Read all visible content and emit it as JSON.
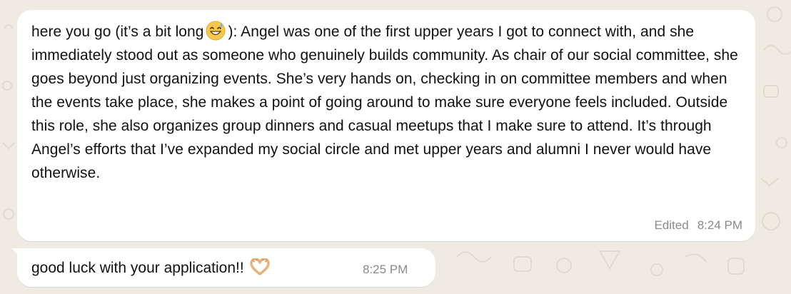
{
  "messages": [
    {
      "text_pre": "here you go (it’s a bit long",
      "emoji": "grinning-sweat-emoji",
      "text_post": "): Angel was one of the first upper years I got to connect with, and she immediately stood out as someone who genuinely builds community. As chair of our social committee, she goes beyond just organizing events. She’s very hands on, checking in on committee members and when the events take place, she makes a point of going around to make sure everyone feels included. Outside this role, she also organizes group dinners and casual meetups that I make sure to attend. It’s through Angel’s efforts that I’ve expanded my social circle and met upper years and alumni I never would have otherwise.",
      "status": "Edited",
      "time": "8:24 PM"
    },
    {
      "text": "good luck with your application!!",
      "emoji": "heart-hands-emoji",
      "time": "8:25 PM"
    }
  ],
  "colors": {
    "background": "#efeae2",
    "bubble": "#ffffff",
    "meta_text": "#8a8a8a",
    "message_text": "#111111"
  }
}
